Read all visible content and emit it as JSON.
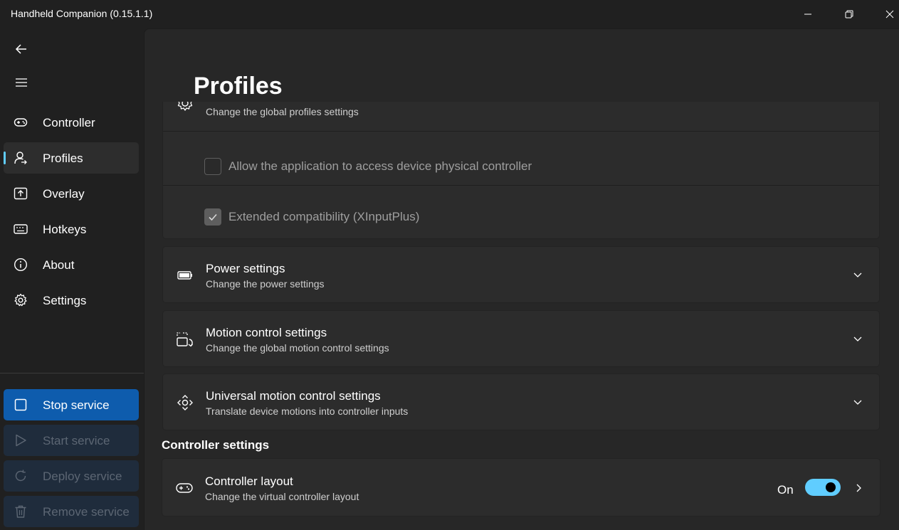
{
  "window": {
    "title": "Handheld Companion (0.15.1.1)",
    "controls": [
      "minimize-icon",
      "restore-icon",
      "close-icon"
    ]
  },
  "sidebar": {
    "back_icon": "arrow-left-icon",
    "menu_icon": "hamburger-icon",
    "items": [
      {
        "label": "Controller",
        "icon": "gamepad-icon",
        "selected": false
      },
      {
        "label": "Profiles",
        "icon": "profile-icon",
        "selected": true
      },
      {
        "label": "Overlay",
        "icon": "overlay-icon",
        "selected": false
      },
      {
        "label": "Hotkeys",
        "icon": "keyboard-icon",
        "selected": false
      },
      {
        "label": "About",
        "icon": "info-icon",
        "selected": false
      },
      {
        "label": "Settings",
        "icon": "gear-icon",
        "selected": false
      }
    ],
    "service_buttons": [
      {
        "label": "Stop service",
        "icon": "stop-icon",
        "enabled": true
      },
      {
        "label": "Start service",
        "icon": "play-icon",
        "enabled": false
      },
      {
        "label": "Deploy service",
        "icon": "refresh-icon",
        "enabled": false
      },
      {
        "label": "Remove service",
        "icon": "trash-icon",
        "enabled": false
      }
    ]
  },
  "main": {
    "page_title": "Profiles",
    "profiles_card": {
      "subtitle": "Change the global profiles settings",
      "options": [
        {
          "label": "Allow the application to access device physical controller",
          "checked": false
        },
        {
          "label": "Extended compatibility (XInputPlus)",
          "checked": true
        }
      ]
    },
    "cards": [
      {
        "title": "Power settings",
        "subtitle": "Change the power settings",
        "icon": "battery-icon"
      },
      {
        "title": "Motion control settings",
        "subtitle": "Change the global motion control settings",
        "icon": "motion-icon"
      },
      {
        "title": "Universal motion control settings",
        "subtitle": "Translate device motions into controller inputs",
        "icon": "direction-pad-icon"
      }
    ],
    "controller_section": {
      "header": "Controller settings",
      "layout_card": {
        "title": "Controller layout",
        "subtitle": "Change the virtual controller layout",
        "toggle_label": "On",
        "toggle_on": true,
        "icon": "gamepad-icon"
      }
    }
  },
  "colors": {
    "accent": "#60cdff",
    "primary_button": "#0e5cad",
    "background": "#202020",
    "card": "#2c2c2c"
  }
}
